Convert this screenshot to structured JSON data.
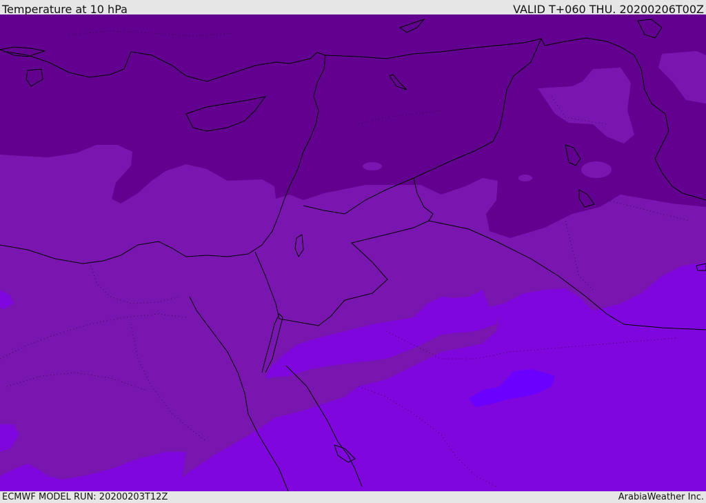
{
  "header": {
    "title": "Temperature at 10 hPa",
    "valid": "VALID T+060 THU. 20200206T00Z"
  },
  "footer": {
    "model_run": "ECMWF MODEL RUN: 20200203T12Z",
    "credit": "ArabiaWeather Inc."
  },
  "colors": {
    "coldest_band": "#62008f",
    "cold_band": "#7a16b0",
    "mid_band": "#7f06dc",
    "warm_patch": "#6a00ff",
    "coastline": "#000000"
  }
}
